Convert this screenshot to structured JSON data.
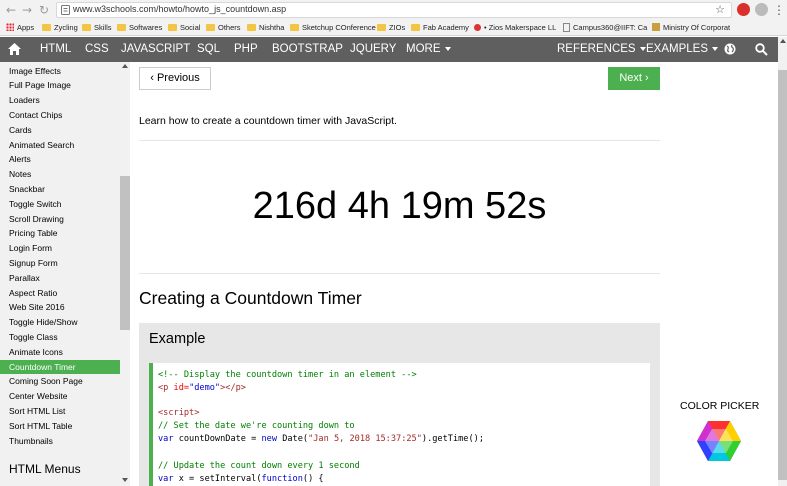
{
  "browser": {
    "url": "www.w3schools.com/howto/howto_js_countdown.asp",
    "bookmarks": [
      {
        "label": "Apps",
        "icon": "apps-grid-icon"
      },
      {
        "label": "Zycling",
        "icon": "folder-icon"
      },
      {
        "label": "Skills",
        "icon": "folder-icon"
      },
      {
        "label": "Softwares",
        "icon": "folder-icon"
      },
      {
        "label": "Social",
        "icon": "folder-icon"
      },
      {
        "label": "Others",
        "icon": "folder-icon"
      },
      {
        "label": "Nishtha",
        "icon": "folder-icon"
      },
      {
        "label": "Sketchup COnference",
        "icon": "folder-icon"
      },
      {
        "label": "ZIOs",
        "icon": "folder-icon"
      },
      {
        "label": "Fab Academy",
        "icon": "folder-icon"
      },
      {
        "label": "• Zios Makerspace LL",
        "icon": "zios-icon"
      },
      {
        "label": "Campus360@IIFT: Ca",
        "icon": "page-icon"
      },
      {
        "label": "Ministry Of Corporat",
        "icon": "ministry-icon"
      }
    ]
  },
  "nav": {
    "items": [
      "HTML",
      "CSS",
      "JAVASCRIPT",
      "SQL",
      "PHP",
      "BOOTSTRAP",
      "JQUERY",
      "MORE"
    ],
    "right_items": [
      "REFERENCES",
      "EXAMPLES"
    ]
  },
  "sidebar": {
    "items": [
      "Image Effects",
      "Full Page Image",
      "Loaders",
      "Contact Chips",
      "Cards",
      "Animated Search",
      "Alerts",
      "Notes",
      "Snackbar",
      "Toggle Switch",
      "Scroll Drawing",
      "Pricing Table",
      "Login Form",
      "Signup Form",
      "Parallax",
      "Aspect Ratio",
      "Web Site 2016",
      "Toggle Hide/Show",
      "Toggle Class",
      "Animate Icons",
      "Countdown Timer",
      "Coming Soon Page",
      "Center Website",
      "Sort HTML List",
      "Sort HTML Table",
      "Thumbnails"
    ],
    "active_item": "Countdown Timer",
    "section_heading": "HTML Menus"
  },
  "main": {
    "prev_label": "Previous",
    "next_label": "Next",
    "intro": "Learn how to create a countdown timer with JavaScript.",
    "countdown": "216d 4h 19m 52s",
    "heading": "Creating a Countdown Timer",
    "example_title": "Example",
    "code": {
      "l1": "<!-- Display the countdown timer in an element -->",
      "l2_open": "<p ",
      "l2_attr": "id=",
      "l2_val": "\"demo\"",
      "l2_close": "></p>",
      "l3": "<script>",
      "l4": "// Set the date we're counting down to",
      "l5_kw": "var",
      "l5_a": " countDownDate = ",
      "l5_kw2": "new",
      "l5_b": " Date(",
      "l5_str": "\"Jan 5, 2018 15:37:25\"",
      "l5_c": ").getTime();",
      "l6": "// Update the count down every 1 second",
      "l7_kw": "var",
      "l7_a": " x = setInterval(",
      "l7_kw2": "function",
      "l7_b": "() {"
    }
  },
  "right": {
    "color_picker_label": "COLOR PICKER"
  },
  "colors": {
    "nav_bg": "#5f5f5f",
    "accent_green": "#4caf50",
    "sidebar_bg": "#f1f1f1",
    "example_bg": "#e7e7e7"
  }
}
